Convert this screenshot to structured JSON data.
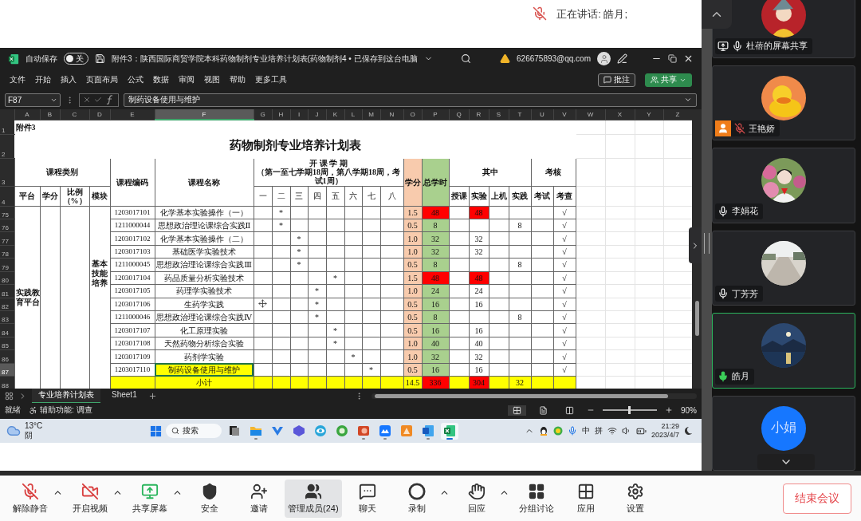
{
  "meeting": {
    "speaking": "正在讲话: 皓月;",
    "mic_muted": true
  },
  "excel": {
    "autosave": {
      "label": "自动保存",
      "on": false,
      "state": "关"
    },
    "title": "附件3：陕西国际商贸学院本科药物制剂专业培养计划表(药物制剂4 • 已保存到这台电脑",
    "account": "626675893@qq.com",
    "ribbon_tabs": [
      "文件",
      "开始",
      "插入",
      "页面布局",
      "公式",
      "数据",
      "审阅",
      "视图",
      "帮助",
      "更多工具"
    ],
    "comment_button": "批注",
    "share_button": "共享",
    "name_box": "F87",
    "formula": "制药设备使用与维护",
    "sheet": {
      "columns": [
        {
          "letter": "A",
          "selected": false
        },
        {
          "letter": "B",
          "selected": false
        },
        {
          "letter": "C",
          "selected": false
        },
        {
          "letter": "D",
          "selected": false
        },
        {
          "letter": "E",
          "selected": false
        },
        {
          "letter": "F",
          "selected": true
        },
        {
          "letter": "G",
          "selected": false
        },
        {
          "letter": "H",
          "selected": false
        },
        {
          "letter": "I",
          "selected": false
        },
        {
          "letter": "J",
          "selected": false
        },
        {
          "letter": "K",
          "selected": false
        },
        {
          "letter": "L",
          "selected": false
        },
        {
          "letter": "M",
          "selected": false
        },
        {
          "letter": "N",
          "selected": false
        },
        {
          "letter": "O",
          "selected": false
        },
        {
          "letter": "P",
          "selected": false
        },
        {
          "letter": "Q",
          "selected": false
        },
        {
          "letter": "R",
          "selected": false
        },
        {
          "letter": "S",
          "selected": false
        },
        {
          "letter": "T",
          "selected": false
        },
        {
          "letter": "U",
          "selected": false
        },
        {
          "letter": "V",
          "selected": false
        },
        {
          "letter": "W",
          "selected": false
        },
        {
          "letter": "X",
          "selected": false
        },
        {
          "letter": "Y",
          "selected": false
        },
        {
          "letter": "Z",
          "selected": false
        }
      ],
      "note": {
        "row": "1",
        "text": "附件3"
      },
      "title": {
        "row": "2",
        "text": "药物制剂专业培养计划表"
      },
      "header_rows": [
        "3",
        "4"
      ],
      "header": {
        "category": "课程类别",
        "platform": "平台",
        "credit": "学分",
        "ratio": [
          "比例",
          "（%）"
        ],
        "module": "模块",
        "code": "课程编码",
        "name": "课程名称",
        "term_title": "开 课 学 期",
        "term_note": "（第一至七学期18周，第八学期18周，考试1周）",
        "terms": [
          "一",
          "二",
          "三",
          "四",
          "五",
          "六",
          "七",
          "八"
        ],
        "credit_total": "学分",
        "hours": "总学时",
        "of_which": "其中",
        "split": [
          "授课",
          "实验",
          "上机",
          "实践"
        ],
        "assessment": "考核",
        "assessment_types": [
          "考试",
          "考查"
        ]
      },
      "platform": "实践教育平台",
      "module": "基本技能培养",
      "rows": [
        {
          "kind": "course",
          "row": "75",
          "code": "1203017101",
          "name": "化学基本实验操作（一）",
          "terms": [
            false,
            true,
            false,
            false,
            false,
            false,
            false,
            false
          ],
          "mark": "*",
          "credit": "1.5",
          "hours": "48",
          "hours_flagged": true,
          "lab": "48",
          "lab_flagged": true,
          "check": "√",
          "selected": false
        },
        {
          "kind": "course",
          "row": "76",
          "code": "1211000044",
          "name": "思想政治理论课综合实践Ⅱ",
          "terms": [
            false,
            true,
            false,
            false,
            false,
            false,
            false,
            false
          ],
          "mark": "*",
          "credit": "0.5",
          "hours": "8",
          "hours_flagged": false,
          "practice": "8",
          "check": "√",
          "selected": false
        },
        {
          "kind": "course",
          "row": "77",
          "code": "1203017102",
          "name": "化学基本实验操作（二）",
          "terms": [
            false,
            false,
            true,
            false,
            false,
            false,
            false,
            false
          ],
          "mark": "*",
          "credit": "1.0",
          "hours": "32",
          "hours_flagged": false,
          "lab": "32",
          "lab_flagged": false,
          "check": "√",
          "selected": false
        },
        {
          "kind": "course",
          "row": "78",
          "code": "1203017103",
          "name": "基础医学实验技术",
          "terms": [
            false,
            false,
            true,
            false,
            false,
            false,
            false,
            false
          ],
          "mark": "*",
          "credit": "1.0",
          "hours": "32",
          "hours_flagged": false,
          "lab": "32",
          "lab_flagged": false,
          "check": "√",
          "selected": false
        },
        {
          "kind": "course",
          "row": "79",
          "code": "1211000045",
          "name": "思想政治理论课综合实践Ⅲ",
          "terms": [
            false,
            false,
            true,
            false,
            false,
            false,
            false,
            false
          ],
          "mark": "*",
          "credit": "0.5",
          "hours": "8",
          "hours_flagged": false,
          "practice": "8",
          "check": "√",
          "selected": false
        },
        {
          "kind": "course",
          "row": "80",
          "code": "1203017104",
          "name": "药品质量分析实验技术",
          "terms": [
            false,
            false,
            false,
            false,
            true,
            false,
            false,
            false
          ],
          "mark": "*",
          "credit": "1.5",
          "hours": "48",
          "hours_flagged": true,
          "lab": "48",
          "lab_flagged": true,
          "check": "√",
          "selected": false
        },
        {
          "kind": "course",
          "row": "81",
          "code": "1203017105",
          "name": "药理学实验技术",
          "terms": [
            false,
            false,
            false,
            true,
            false,
            false,
            false,
            false
          ],
          "mark": "*",
          "credit": "1.0",
          "hours": "24",
          "hours_flagged": false,
          "lab": "24",
          "lab_flagged": false,
          "check": "√",
          "selected": false
        },
        {
          "kind": "course",
          "row": "82",
          "code": "1203017106",
          "name": "生药学实践",
          "terms": [
            false,
            false,
            false,
            true,
            false,
            false,
            false,
            false
          ],
          "mark": "*",
          "credit": "0.5",
          "hours": "16",
          "hours_flagged": false,
          "lab": "16",
          "lab_flagged": false,
          "check": "√",
          "selected": false,
          "cursor": true
        },
        {
          "kind": "course",
          "row": "83",
          "code": "1211000046",
          "name": "思想政治理论课综合实践Ⅳ",
          "terms": [
            false,
            false,
            false,
            true,
            false,
            false,
            false,
            false
          ],
          "mark": "*",
          "credit": "0.5",
          "hours": "8",
          "hours_flagged": false,
          "practice": "8",
          "check": "√",
          "selected": false
        },
        {
          "kind": "course",
          "row": "84",
          "code": "1203017107",
          "name": "化工原理实验",
          "terms": [
            false,
            false,
            false,
            false,
            true,
            false,
            false,
            false
          ],
          "mark": "*",
          "credit": "0.5",
          "hours": "16",
          "hours_flagged": false,
          "lab": "16",
          "lab_flagged": false,
          "check": "√",
          "selected": false
        },
        {
          "kind": "course",
          "row": "85",
          "code": "1203017108",
          "name": "天然药物分析综合实验",
          "terms": [
            false,
            false,
            false,
            false,
            true,
            false,
            false,
            false
          ],
          "mark": "*",
          "credit": "1.0",
          "hours": "40",
          "hours_flagged": false,
          "lab": "40",
          "lab_flagged": false,
          "check": "√",
          "selected": false
        },
        {
          "kind": "course",
          "row": "86",
          "code": "1203017109",
          "name": "药剂学实验",
          "terms": [
            false,
            false,
            false,
            false,
            false,
            true,
            false,
            false
          ],
          "mark": "*",
          "credit": "1.0",
          "hours": "32",
          "hours_flagged": false,
          "lab": "32",
          "lab_flagged": false,
          "check": "√",
          "selected": false
        },
        {
          "kind": "course",
          "row": "87",
          "code": "1203017110",
          "name": "制药设备使用与维护",
          "terms": [
            false,
            false,
            false,
            false,
            false,
            false,
            true,
            false
          ],
          "mark": "*",
          "credit": "0.5",
          "hours": "16",
          "hours_flagged": false,
          "lab": "16",
          "lab_flagged": false,
          "check": "√",
          "selected": true
        },
        {
          "kind": "subtotal",
          "row": "88",
          "name": "小计",
          "credit": "14.5",
          "hours": "336",
          "hours_flagged": true,
          "lab": "304",
          "lab_flagged": true,
          "practice": "32",
          "selected": false
        }
      ]
    },
    "sheet_tabs": [
      {
        "label": "专业培养计划表",
        "selected": true
      },
      {
        "label": "Sheet1",
        "selected": false
      }
    ],
    "status": {
      "ready": "就绪",
      "accessibility": "辅助功能: 调查",
      "view_modes": [
        {
          "kind": "normal",
          "selected": true
        },
        {
          "kind": "page-layout",
          "selected": false
        },
        {
          "kind": "page-break",
          "selected": false
        }
      ],
      "zoom": {
        "level": 0.48,
        "reading": "90%"
      }
    }
  },
  "taskbar": {
    "weather": {
      "temperature": "13°C",
      "condition": "阴"
    },
    "search": "搜索",
    "apps": [
      {
        "kind": "task-view",
        "running": false,
        "active": false
      },
      {
        "kind": "folder",
        "running": true,
        "active": false
      },
      {
        "kind": "v-app",
        "running": false,
        "active": false
      },
      {
        "kind": "triangle-app",
        "running": false,
        "active": false
      },
      {
        "kind": "eye-app",
        "running": false,
        "active": false
      },
      {
        "kind": "browser",
        "running": false,
        "active": false
      },
      {
        "kind": "slides",
        "running": true,
        "active": false
      },
      {
        "kind": "meeting",
        "running": true,
        "active": false
      },
      {
        "kind": "pdf",
        "running": false,
        "active": false
      },
      {
        "kind": "docs",
        "running": true,
        "active": false
      },
      {
        "kind": "sheets",
        "running": true,
        "active": true
      }
    ],
    "ime_mode": "中",
    "ime": "拼",
    "time": "21:29",
    "date": "2023/4/7"
  },
  "participants": [
    {
      "name": "杜蓓的屏幕共享",
      "kind": "cartoon",
      "sharing": true,
      "person_badge": false,
      "muted": false,
      "speaking": false
    },
    {
      "name": "王艳娇",
      "kind": "duck",
      "sharing": false,
      "person_badge": true,
      "muted": true,
      "speaking": false
    },
    {
      "name": "李娟花",
      "kind": "portrait",
      "sharing": false,
      "person_badge": false,
      "muted": false,
      "speaking": false
    },
    {
      "name": "丁芳芳",
      "kind": "road",
      "sharing": false,
      "person_badge": false,
      "muted": false,
      "speaking": false
    },
    {
      "name": "皓月",
      "kind": "moon",
      "sharing": false,
      "person_badge": false,
      "muted": false,
      "speaking": true
    },
    {
      "kind": "initials",
      "initials": "小娟",
      "speaking": false
    }
  ],
  "toolbar": {
    "items": [
      {
        "label": "解除静音",
        "kind": "mic-off",
        "menu": true,
        "selected": false
      },
      {
        "label": "开启视频",
        "kind": "video-off",
        "menu": true,
        "selected": false
      },
      {
        "label": "共享屏幕",
        "kind": "share",
        "menu": true,
        "selected": false
      },
      {
        "label": "安全",
        "kind": "shield",
        "menu": false,
        "selected": false
      },
      {
        "label": "邀请",
        "kind": "invite",
        "menu": false,
        "selected": false
      },
      {
        "label": "管理成员(24)",
        "kind": "members",
        "menu": false,
        "selected": true
      },
      {
        "label": "聊天",
        "kind": "chat",
        "menu": false,
        "selected": false
      },
      {
        "label": "录制",
        "kind": "record",
        "menu": true,
        "selected": false
      },
      {
        "label": "回应",
        "kind": "react",
        "menu": true,
        "selected": false
      },
      {
        "label": "分组讨论",
        "kind": "breakout",
        "menu": false,
        "selected": false
      },
      {
        "label": "应用",
        "kind": "apps",
        "menu": false,
        "selected": false
      },
      {
        "label": "设置",
        "kind": "settings",
        "menu": false,
        "selected": false
      }
    ],
    "end_button": "结束会议"
  }
}
